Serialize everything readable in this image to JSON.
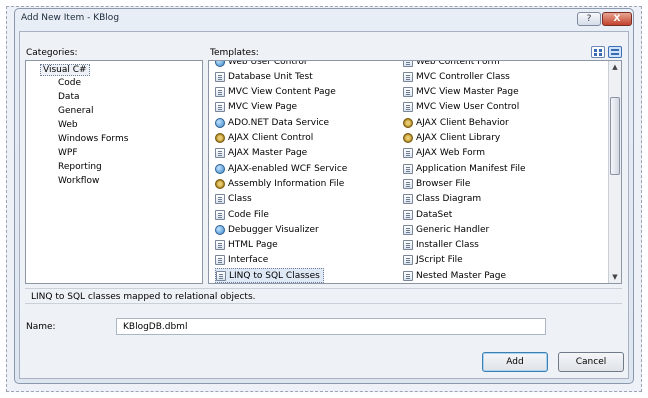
{
  "window": {
    "title": "Add New Item - KBlog",
    "help_glyph": "?",
    "close_glyph": "X"
  },
  "labels": {
    "categories": "Categories:",
    "templates": "Templates:",
    "name": "Name:"
  },
  "categories": [
    {
      "label": "Visual C#",
      "selected": true,
      "indent": 0
    },
    {
      "label": "Code",
      "indent": 1
    },
    {
      "label": "Data",
      "indent": 1
    },
    {
      "label": "General",
      "indent": 1
    },
    {
      "label": "Web",
      "indent": 1
    },
    {
      "label": "Windows Forms",
      "indent": 1
    },
    {
      "label": "WPF",
      "indent": 1
    },
    {
      "label": "Reporting",
      "indent": 1
    },
    {
      "label": "Workflow",
      "indent": 1
    }
  ],
  "templates_left": [
    {
      "label": "Web User Control",
      "icon": "globe"
    },
    {
      "label": "Database Unit Test",
      "icon": "doc"
    },
    {
      "label": "MVC View Content Page",
      "icon": "doc"
    },
    {
      "label": "MVC View Page",
      "icon": "doc"
    },
    {
      "label": "ADO.NET Data Service",
      "icon": "globe"
    },
    {
      "label": "AJAX Client Control",
      "icon": "gear"
    },
    {
      "label": "AJAX Master Page",
      "icon": "doc"
    },
    {
      "label": "AJAX-enabled WCF Service",
      "icon": "globe"
    },
    {
      "label": "Assembly Information File",
      "icon": "gear"
    },
    {
      "label": "Class",
      "icon": "doc"
    },
    {
      "label": "Code File",
      "icon": "doc"
    },
    {
      "label": "Debugger Visualizer",
      "icon": "globe"
    },
    {
      "label": "HTML Page",
      "icon": "doc"
    },
    {
      "label": "Interface",
      "icon": "doc"
    },
    {
      "label": "LINQ to SQL Classes",
      "icon": "doc",
      "selected": true
    }
  ],
  "templates_right": [
    {
      "label": "Web Content Form",
      "icon": "doc"
    },
    {
      "label": "MVC Controller Class",
      "icon": "doc"
    },
    {
      "label": "MVC View Master Page",
      "icon": "doc"
    },
    {
      "label": "MVC View User Control",
      "icon": "doc"
    },
    {
      "label": "AJAX Client Behavior",
      "icon": "gear"
    },
    {
      "label": "AJAX Client Library",
      "icon": "gear"
    },
    {
      "label": "AJAX Web Form",
      "icon": "doc"
    },
    {
      "label": "Application Manifest File",
      "icon": "doc"
    },
    {
      "label": "Browser File",
      "icon": "doc"
    },
    {
      "label": "Class Diagram",
      "icon": "doc"
    },
    {
      "label": "DataSet",
      "icon": "doc"
    },
    {
      "label": "Generic Handler",
      "icon": "doc"
    },
    {
      "label": "Installer Class",
      "icon": "doc"
    },
    {
      "label": "JScript File",
      "icon": "doc"
    },
    {
      "label": "Nested Master Page",
      "icon": "doc"
    }
  ],
  "scrollbar": {
    "up_glyph": "▲",
    "down_glyph": "▼"
  },
  "description": "LINQ to SQL classes mapped to relational objects.",
  "name_field": {
    "value": "KBlogDB.dbml"
  },
  "buttons": {
    "add": "Add",
    "cancel": "Cancel"
  }
}
